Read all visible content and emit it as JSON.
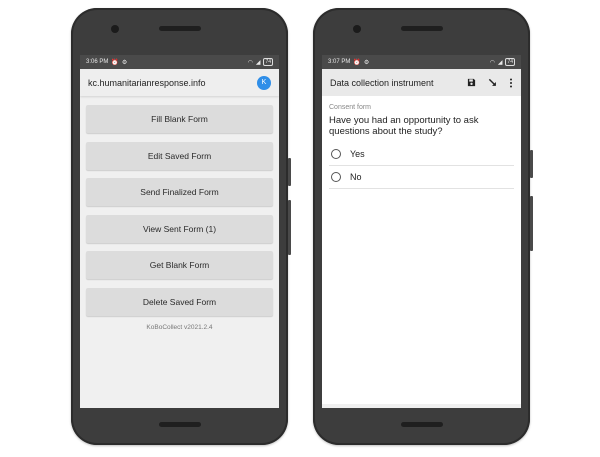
{
  "left_phone": {
    "status": {
      "time": "3:06 PM",
      "battery": "74"
    },
    "appbar": {
      "title": "kc.humanitarianresponse.info",
      "avatar_letter": "K"
    },
    "menu": [
      "Fill Blank Form",
      "Edit Saved Form",
      "Send Finalized Form",
      "View Sent Form (1)",
      "Get Blank Form",
      "Delete Saved Form"
    ],
    "version": "KoBoCollect v2021.2.4"
  },
  "right_phone": {
    "status": {
      "time": "3:07 PM",
      "battery": "74"
    },
    "appbar": {
      "title": "Data collection instrument",
      "icons": [
        "save-icon",
        "jump-icon",
        "more-icon"
      ]
    },
    "group_label": "Consent form",
    "question": "Have you had an opportunity to ask questions about the study?",
    "options": [
      "Yes",
      "No"
    ]
  },
  "colors": {
    "accent": "#2f8ee8",
    "phone_body": "#3d3d3d",
    "button": "#dcdcdc"
  }
}
